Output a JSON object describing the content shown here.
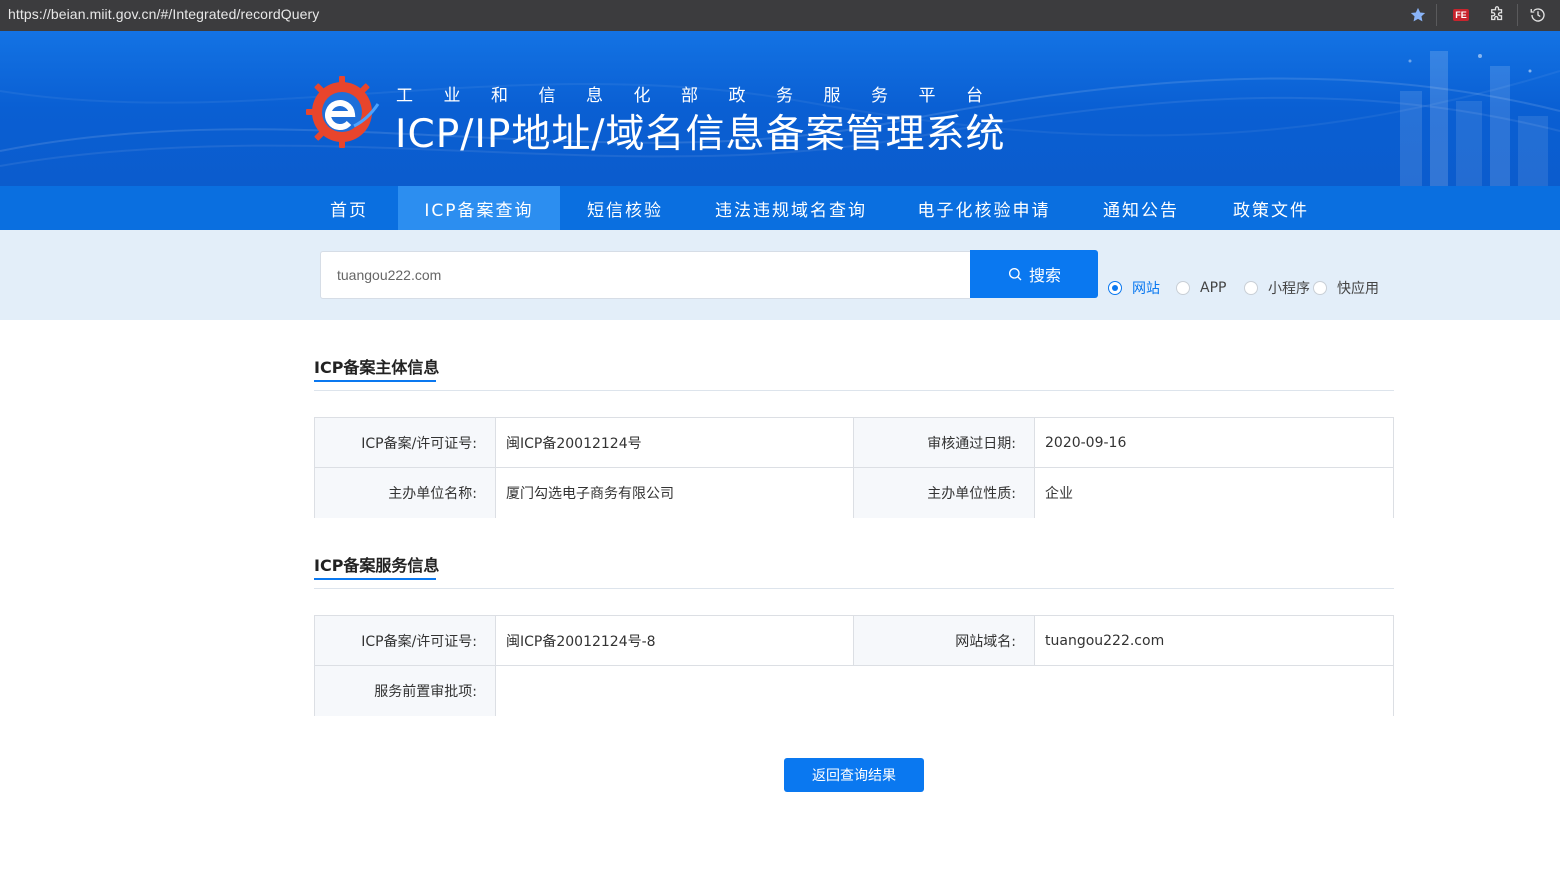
{
  "browser": {
    "url": "https://beian.miit.gov.cn/#/Integrated/recordQuery",
    "extension_badge": "FE"
  },
  "header": {
    "subtitle": "工业和信息化部政务服务平台",
    "title": "ICP/IP地址/域名信息备案管理系统"
  },
  "nav": {
    "items": [
      {
        "label": "首页"
      },
      {
        "label": "ICP备案查询"
      },
      {
        "label": "短信核验"
      },
      {
        "label": "违法违规域名查询"
      },
      {
        "label": "电子化核验申请"
      },
      {
        "label": "通知公告"
      },
      {
        "label": "政策文件"
      }
    ],
    "active_index": 1
  },
  "search": {
    "value": "tuangou222.com",
    "button_label": "搜索",
    "types": [
      {
        "label": "网站",
        "checked": true
      },
      {
        "label": "APP",
        "checked": false
      },
      {
        "label": "小程序",
        "checked": false
      },
      {
        "label": "快应用",
        "checked": false
      }
    ]
  },
  "subject_section": {
    "title": "ICP备案主体信息",
    "rows": [
      {
        "label1": "ICP备案/许可证号:",
        "value1": "闽ICP备20012124号",
        "label2": "审核通过日期:",
        "value2": "2020-09-16"
      },
      {
        "label1": "主办单位名称:",
        "value1": "厦门勾选电子商务有限公司",
        "label2": "主办单位性质:",
        "value2": "企业"
      }
    ]
  },
  "service_section": {
    "title": "ICP备案服务信息",
    "row1": {
      "label1": "ICP备案/许可证号:",
      "value1": "闽ICP备20012124号-8",
      "label2": "网站域名:",
      "value2": "tuangou222.com"
    },
    "row2": {
      "label": "服务前置审批项:",
      "value": ""
    }
  },
  "actions": {
    "back_label": "返回查询结果"
  },
  "colors": {
    "primary": "#0a78f0",
    "nav_bg": "#0a6fe0",
    "nav_active": "#2c8ef0",
    "banner": "#0b5ccd",
    "search_bg": "#e3eef9"
  }
}
